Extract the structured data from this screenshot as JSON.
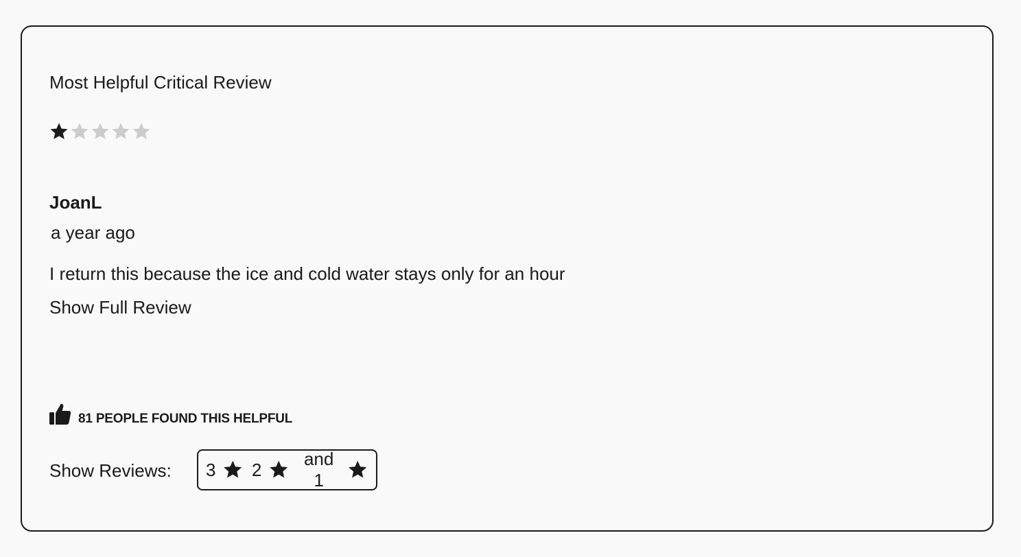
{
  "review": {
    "heading": "Most Helpful Critical Review",
    "rating": 1,
    "max_rating": 5,
    "star_filled_color": "#1a1a1a",
    "star_empty_color": "#cccccc",
    "reviewer": "JoanL",
    "time": "a year ago",
    "text": "I return this because the ice and cold water stays only for an hour",
    "show_full_label": "Show Full Review",
    "helpful_text": "81 PEOPLE FOUND THIS HELPFUL"
  },
  "filter": {
    "label": "Show Reviews:",
    "first": "3",
    "second": "2",
    "and_label": "and 1"
  }
}
